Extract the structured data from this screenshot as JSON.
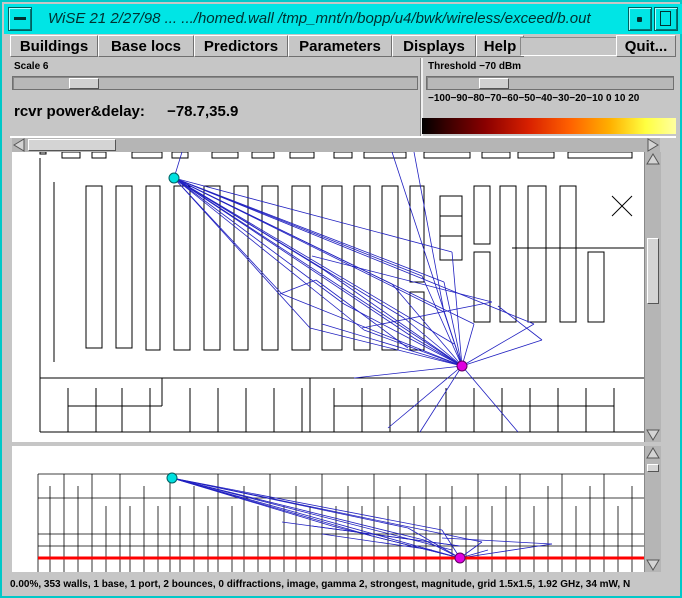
{
  "window": {
    "title": "WiSE 21 2/27/98  ...  .../homed.wall /tmp_mnt/n/bopp/u4/bwk/wireless/exceed/b.out"
  },
  "menu": {
    "buildings": "Buildings",
    "base_locs": "Base locs",
    "predictors": "Predictors",
    "parameters": "Parameters",
    "displays": "Displays",
    "help": "Help",
    "quit": "Quit..."
  },
  "scale": {
    "label": "Scale 6"
  },
  "threshold": {
    "label": "Threshold  −70 dBm",
    "ticks": "−100−90−80−70−60−50−40−30−20−10  0   10  20"
  },
  "readout": {
    "label": "rcvr power&delay:",
    "value": "−78.7,35.9"
  },
  "status": {
    "text": "0.00%, 353 walls, 1 base, 1 port, 2 bounces, 0 diffractions, image, gamma 2, strongest, magnitude, grid 1.5x1.5, 1.92 GHz, 34 mW, N"
  },
  "colors": {
    "titlebar": "#00e5e5",
    "ray": "#2020c0",
    "transmitter": "#00e0e0",
    "receiver": "#e000e0",
    "floor_line": "#ff0000"
  }
}
